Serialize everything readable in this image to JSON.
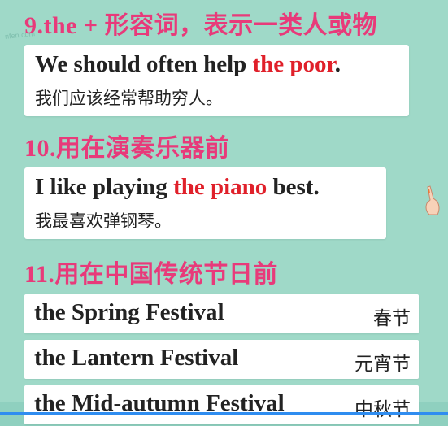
{
  "watermark": "nfen.com",
  "section9": {
    "heading": "9.the + 形容词，表示一类人或物",
    "example": {
      "en_before": "We should often help ",
      "en_highlight": "the poor",
      "en_after": ".",
      "cn": "我们应该经常帮助穷人。"
    }
  },
  "section10": {
    "heading": "10.用在演奏乐器前",
    "example": {
      "en_before": "I like playing ",
      "en_highlight": "the piano",
      "en_after": " best.",
      "cn": "我最喜欢弹钢琴。"
    }
  },
  "section11": {
    "heading": "11.用在中国传统节日前",
    "festivals": [
      {
        "en": "the Spring Festival",
        "cn": "春节"
      },
      {
        "en": "the Lantern Festival",
        "cn": "元宵节"
      },
      {
        "en": "the Mid-autumn Festival",
        "cn": "中秋节"
      }
    ]
  },
  "video": {
    "progress": 1.0,
    "progress_color": "#2f8df0"
  },
  "colors": {
    "background": "#9fd9c8",
    "heading": "#e83a7a",
    "highlight": "#e0202a"
  }
}
